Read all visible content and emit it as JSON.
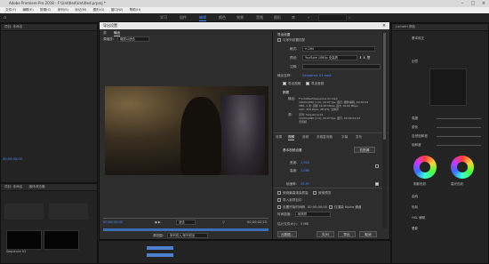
{
  "app": {
    "title": "Adobe Premiere Pro 2018 - F:\\Untitled\\Untitled.prproj *"
  },
  "menu": [
    "文件(F)",
    "编辑(E)",
    "剪辑(C)",
    "序列(S)",
    "标记(M)",
    "图形(G)",
    "窗口(W)",
    "帮助(H)"
  ],
  "workspaces": [
    "学习",
    "组件",
    "编辑",
    "颜色",
    "效果",
    "音频",
    "图形",
    "库"
  ],
  "active_workspace": "颜色",
  "left_panel": {
    "timecode": "00;00;00;00",
    "project_label": "项目: 未命名",
    "search_placeholder": "",
    "items_count": "1 项"
  },
  "dialog": {
    "title": "导出设置",
    "source_tab": "源",
    "output_tab": "输出",
    "source_scale_label": "源缩放:",
    "source_scale_value": "缩放以适合",
    "export_settings_header": "导出设置",
    "match_sequence_label": "与序列设置匹配",
    "format_label": "格式:",
    "format_value": "H.264",
    "preset_label": "预设:",
    "preset_value": "YouTube 1080p 全高清",
    "comments_label": "注释:",
    "output_name_label": "输出名称:",
    "output_name_value": "Sequence 01.mp4",
    "export_video_label": "导出视频",
    "export_audio_label": "导出音频",
    "summary_header": "摘要",
    "summary_output_title": "输出:",
    "summary_output_lines": [
      "F:\\Untitled\\Sequence 01.mp4",
      "1920x1080 (1.0), 29.97 fps, 逐行, 硬件编码, 00:00:02",
      "VBR, 1 次, 目标 16.00 Mbps, 最大 16.00 Mbps",
      "AAC, 320 kbps, 48 kHz, 立体声"
    ],
    "summary_source_title": "源:",
    "summary_source_lines": [
      "序列, Sequence 01",
      "1920x1080 (1.0), 29.97 fps, 逐行, 00:00:02:23",
      "无音频"
    ],
    "tabs": [
      "效果",
      "视频",
      "音频",
      "多路复用器",
      "字幕",
      "发布"
    ],
    "active_tab": "视频",
    "basic_video_header": "基本视频设置",
    "match_source_button": "匹配源",
    "width_label": "宽度:",
    "width_value": "1,920",
    "height_label": "高度:",
    "height_value": "1,080",
    "framerate_label": "帧速率:",
    "framerate_value": "29.97",
    "use_max_render_label": "使用最高渲染质量",
    "use_previews_label": "使用预览",
    "import_project_label": "导入到项目中",
    "set_start_timecode_label": "设置开始时间码",
    "start_timecode_value": "00;00;00;00",
    "render_alpha_label": "仅渲染 Alpha 通道",
    "time_interpolation_label": "时间插值:",
    "time_interpolation_value": "帧采样",
    "file_size_label": "估计文件大小:",
    "file_size_value": "5 MB",
    "metadata_button": "元数据...",
    "queue_button": "队列",
    "export_button": "导出",
    "cancel_button": "取消",
    "timecode_in": "00;00;00;00",
    "timecode_out": "00;00;02;23",
    "fit_label": "适合",
    "source_range_label": "源范围:",
    "source_range_value": "序列切入/序列切出"
  },
  "right_panel": {
    "header": "Lumetri 颜色",
    "section_basic": "基本校正",
    "section_creative": "创意",
    "section_curves": "曲线",
    "section_wheels": "色轮",
    "section_hsl": "HSL 辅助",
    "section_vignette": "晕影",
    "labels_left": [
      "强度",
      "锐化",
      "自然饱和度",
      "饱和度",
      "阴影色彩",
      "高光色彩"
    ],
    "accent": "#4d8cff"
  },
  "bottom_left": {
    "tabs": [
      "项目: 未命名",
      "媒体浏览器"
    ],
    "thumb_labels": [
      "Sequence 01",
      "00:05"
    ]
  }
}
